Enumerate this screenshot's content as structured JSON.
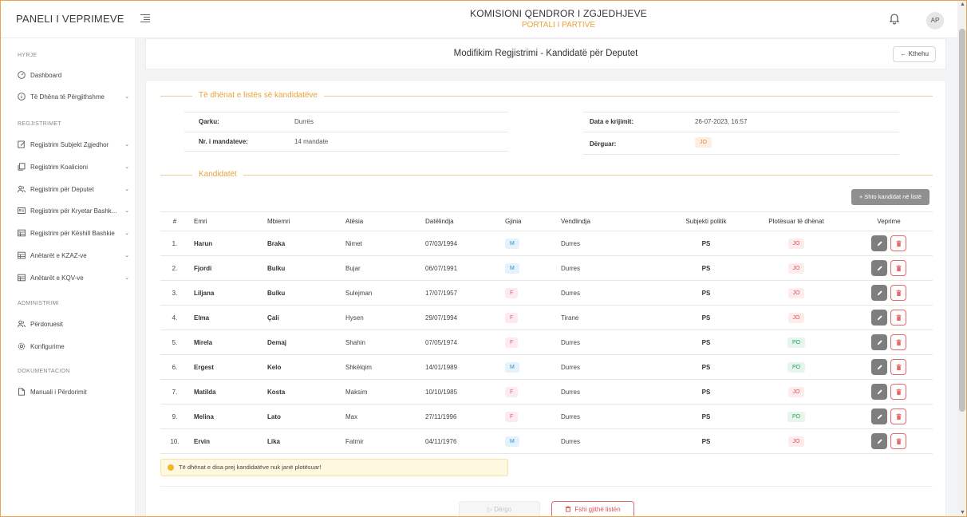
{
  "topbar": {
    "brand": "PANELI I VEPRIMEVE",
    "title": "KOMISIONI QENDROR I ZGJEDHJEVE",
    "subtitle": "PORTALI I PARTIVE",
    "avatar": "AP"
  },
  "sidebar": {
    "sections": [
      "HYRJE",
      "REGJISTRIMET",
      "ADMINISTRIMI",
      "DOKUMENTACION"
    ],
    "items": [
      {
        "label": "Dashboard",
        "icon": "dashboard-icon"
      },
      {
        "label": "Të Dhëna të Përgjithshme",
        "icon": "info-icon"
      },
      {
        "label": "Regjistrim Subjekt Zgjedhor",
        "icon": "edit-doc-icon"
      },
      {
        "label": "Regjistrim Koalicioni",
        "icon": "copy-icon"
      },
      {
        "label": "Regjistrim për Deputet",
        "icon": "users-icon"
      },
      {
        "label": "Regjistrim për Kryetar Bashk...",
        "icon": "idcard-icon"
      },
      {
        "label": "Regjistrim për Këshill Bashkie",
        "icon": "table-icon"
      },
      {
        "label": "Anëtarët e KZAZ-ve",
        "icon": "table-icon"
      },
      {
        "label": "Anëtarët e KQV-ve",
        "icon": "table-icon"
      },
      {
        "label": "Përdoruesit",
        "icon": "users-icon"
      },
      {
        "label": "Konfigurime",
        "icon": "gear-icon"
      },
      {
        "label": "Manuali i Përdorimit",
        "icon": "file-icon"
      }
    ]
  },
  "header": {
    "title": "Modifikim Regjistrimi - Kandidatë për Deputet",
    "back_label": "← Kthehu"
  },
  "list_info": {
    "section_title": "Të dhënat e listës së kandidatëve",
    "qarku_label": "Qarku:",
    "qarku_value": "Durrës",
    "mandate_label": "Nr. i mandateve:",
    "mandate_value": "14 mandate",
    "date_label": "Data e krijimit:",
    "date_value": "26-07-2023, 16:57",
    "sent_label": "Dërguar:",
    "sent_value": "JO"
  },
  "candidates": {
    "section_title": "Kandidatët",
    "add_button": "+ Shto kandidat në listë",
    "headers": [
      "#",
      "Emri",
      "Mbiemri",
      "Atësia",
      "Datëlindja",
      "Gjinia",
      "Vendlindja",
      "Subjekti politik",
      "Plotësuar të dhënat",
      "Veprime"
    ],
    "rows": [
      {
        "num": "1.",
        "emri": "Harun",
        "mbiemri": "Braka",
        "atesia": "Nimet",
        "date": "07/03/1994",
        "gjinia": "M",
        "vendlindja": "Durres",
        "subjekti": "PS",
        "plotesuar": "JO"
      },
      {
        "num": "2.",
        "emri": "Fjordi",
        "mbiemri": "Bulku",
        "atesia": "Bujar",
        "date": "06/07/1991",
        "gjinia": "M",
        "vendlindja": "Durres",
        "subjekti": "PS",
        "plotesuar": "JO"
      },
      {
        "num": "3.",
        "emri": "Liljana",
        "mbiemri": "Bulku",
        "atesia": "Sulejman",
        "date": "17/07/1957",
        "gjinia": "F",
        "vendlindja": "Durres",
        "subjekti": "PS",
        "plotesuar": "JO"
      },
      {
        "num": "4.",
        "emri": "Elma",
        "mbiemri": "Çali",
        "atesia": "Hysen",
        "date": "29/07/1994",
        "gjinia": "F",
        "vendlindja": "Tirane",
        "subjekti": "PS",
        "plotesuar": "JO"
      },
      {
        "num": "5.",
        "emri": "Mirela",
        "mbiemri": "Demaj",
        "atesia": "Shahin",
        "date": "07/05/1974",
        "gjinia": "F",
        "vendlindja": "Durres",
        "subjekti": "PS",
        "plotesuar": "PO"
      },
      {
        "num": "6.",
        "emri": "Ergest",
        "mbiemri": "Kelo",
        "atesia": "Shkëlqim",
        "date": "14/01/1989",
        "gjinia": "M",
        "vendlindja": "Durres",
        "subjekti": "PS",
        "plotesuar": "PO"
      },
      {
        "num": "7.",
        "emri": "Matilda",
        "mbiemri": "Kosta",
        "atesia": "Maksim",
        "date": "10/10/1985",
        "gjinia": "F",
        "vendlindja": "Durres",
        "subjekti": "PS",
        "plotesuar": "JO"
      },
      {
        "num": "9.",
        "emri": "Melina",
        "mbiemri": "Lato",
        "atesia": "Max",
        "date": "27/11/1996",
        "gjinia": "F",
        "vendlindja": "Durres",
        "subjekti": "PS",
        "plotesuar": "PO"
      },
      {
        "num": "10.",
        "emri": "Ervin",
        "mbiemri": "Lika",
        "atesia": "Fatmir",
        "date": "04/11/1976",
        "gjinia": "M",
        "vendlindja": "Durres",
        "subjekti": "PS",
        "plotesuar": "JO"
      }
    ]
  },
  "warning": "Të dhënat e disa prej kandidatëve nuk janë plotësuar!",
  "footer": {
    "send_label": "▷ Dërgo",
    "delete_all_label": "Fshi gjithë listën"
  },
  "colors": {
    "accent": "#e8a23b",
    "danger": "#d9534f",
    "success": "#2f9e5b"
  }
}
